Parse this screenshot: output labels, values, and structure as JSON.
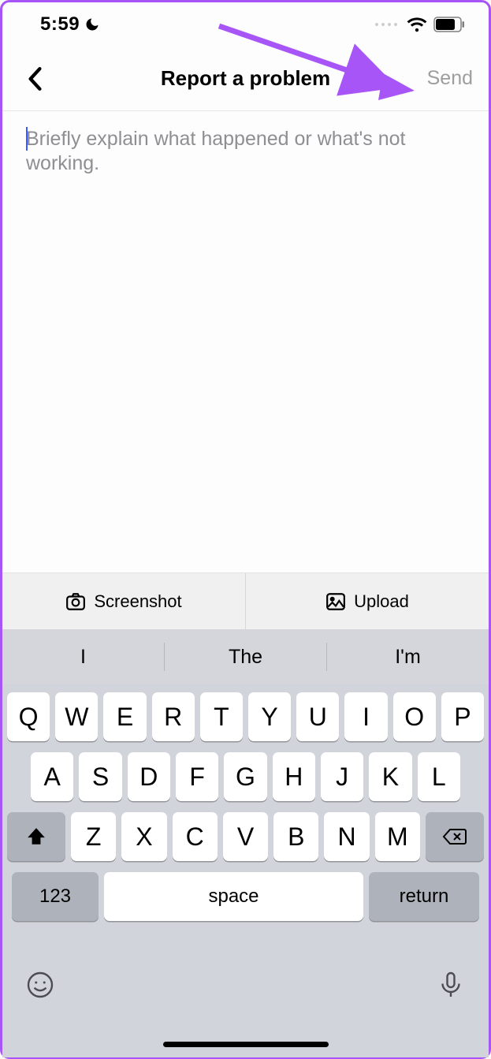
{
  "status": {
    "time": "5:59"
  },
  "header": {
    "title": "Report a problem",
    "send_label": "Send"
  },
  "textarea": {
    "placeholder": "Briefly explain what happened or what's not working."
  },
  "attach": {
    "screenshot_label": "Screenshot",
    "upload_label": "Upload"
  },
  "keyboard": {
    "suggestions": [
      "I",
      "The",
      "I'm"
    ],
    "row1": [
      "Q",
      "W",
      "E",
      "R",
      "T",
      "Y",
      "U",
      "I",
      "O",
      "P"
    ],
    "row2": [
      "A",
      "S",
      "D",
      "F",
      "G",
      "H",
      "J",
      "K",
      "L"
    ],
    "row3": [
      "Z",
      "X",
      "C",
      "V",
      "B",
      "N",
      "M"
    ],
    "numkey": "123",
    "space": "space",
    "return": "return"
  }
}
